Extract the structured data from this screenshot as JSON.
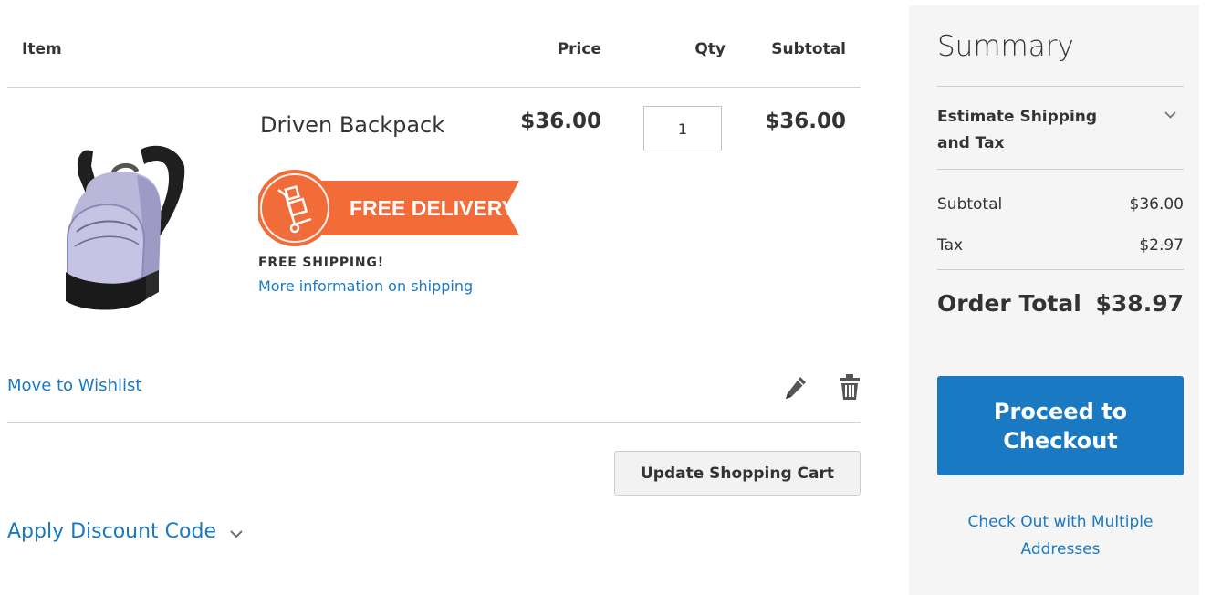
{
  "cart": {
    "headers": {
      "item": "Item",
      "price": "Price",
      "qty": "Qty",
      "subtotal": "Subtotal"
    },
    "item": {
      "name": "Driven Backpack",
      "price": "$36.00",
      "qty": "1",
      "subtotal": "$36.00",
      "badge_text": "FREE DELIVERY",
      "shipping_note": "FREE SHIPPING!",
      "shipping_link": "More information on shipping",
      "wishlist_link": "Move to Wishlist",
      "image_icon": "backpack-product-image",
      "edit_icon": "pencil-icon",
      "delete_icon": "trash-icon"
    },
    "update_button": "Update Shopping Cart",
    "discount_label": "Apply Discount Code"
  },
  "summary": {
    "title": "Summary",
    "estimate_shipping": "Estimate Shipping and Tax",
    "subtotal_label": "Subtotal",
    "subtotal_value": "$36.00",
    "tax_label": "Tax",
    "tax_value": "$2.97",
    "order_total_label": "Order Total",
    "order_total_value": "$38.97",
    "checkout_button": "Proceed to Checkout",
    "multi_address_link": "Check Out with Multiple Addresses"
  },
  "colors": {
    "link": "#1979c3",
    "primary_button": "#1979c3",
    "badge": "#f26c3a",
    "summary_bg": "#f5f5f5"
  }
}
